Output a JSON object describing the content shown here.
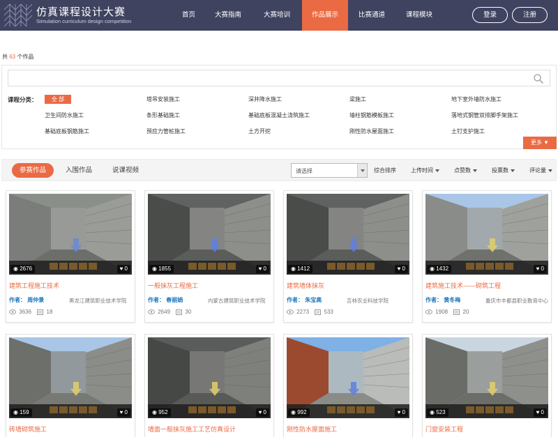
{
  "header": {
    "title": "仿真课程设计大赛",
    "subtitle": "Simulation curriculum design competition",
    "nav": [
      "首页",
      "大赛指南",
      "大赛培训",
      "作品展示",
      "比赛通道",
      "课程模块"
    ],
    "active_nav": 3,
    "login": "登录",
    "register": "注册"
  },
  "summary": {
    "prefix": "共",
    "count": "63",
    "suffix": "个作品"
  },
  "filter": {
    "search_placeholder": "",
    "category_label": "课程分类：",
    "all_label": "全 部",
    "categories": [
      "塔吊安装施工",
      "深井降水施工",
      "梁施工",
      "地下室外墙防水施工",
      "卫生间防水施工",
      "条形基础施工",
      "基础底板混凝土浇筑施工",
      "墙柱钢筋模板施工",
      "落地式钢管双排脚手架施工",
      "基础底板钢筋施工",
      "预应力管桩施工",
      "土方开挖",
      "刚性防水屋面施工",
      "土钉支护施工"
    ],
    "more_label": "更多 ▼"
  },
  "tabs": {
    "items": [
      "参赛作品",
      "入围作品",
      "说课视频"
    ],
    "active": 0,
    "select_value": "请选择",
    "sorts": [
      "综合排序",
      "上传时间",
      "点赞数",
      "投票数",
      "评论量"
    ]
  },
  "cards": [
    {
      "views": "2676",
      "likes": "0",
      "title": "建筑工程施工技术",
      "author_label": "作者：",
      "author": "周仲景",
      "org": "黑龙江建筑职业技术学院",
      "comments": "3636",
      "downloads": "18"
    },
    {
      "views": "1855",
      "likes": "0",
      "title": "一般抹灰工程施工",
      "author_label": "作者：",
      "author": "春丽娟",
      "org": "内蒙古建筑职业技术学院",
      "comments": "2649",
      "downloads": "30"
    },
    {
      "views": "1412",
      "likes": "0",
      "title": "建筑墙体抹灰",
      "author_label": "作者：",
      "author": "朱宝高",
      "org": "吉林农业科技学院",
      "comments": "2273",
      "downloads": "533"
    },
    {
      "views": "1432",
      "likes": "0",
      "title": "建筑施工技术——砌筑工程",
      "author_label": "作者：",
      "author": "黄冬梅",
      "org": "重庆市丰都县职业教育中心",
      "comments": "1908",
      "downloads": "20"
    },
    {
      "views": "159",
      "likes": "0",
      "title": "砖墙砌筑施工",
      "author_label": "",
      "author": "",
      "org": "",
      "comments": "",
      "downloads": ""
    },
    {
      "views": "952",
      "likes": "0",
      "title": "墙面一般抹灰施工工艺仿真设计",
      "author_label": "",
      "author": "",
      "org": "",
      "comments": "",
      "downloads": ""
    },
    {
      "views": "992",
      "likes": "0",
      "title": "刚性防水屋面施工",
      "author_label": "",
      "author": "",
      "org": "",
      "comments": "",
      "downloads": ""
    },
    {
      "views": "523",
      "likes": "0",
      "title": "门窗安装工程",
      "author_label": "",
      "author": "",
      "org": "",
      "comments": "",
      "downloads": ""
    }
  ],
  "colors": {
    "header_bg": "#3f4360",
    "accent": "#ea6a44",
    "author_blue": "#1b75bb"
  }
}
